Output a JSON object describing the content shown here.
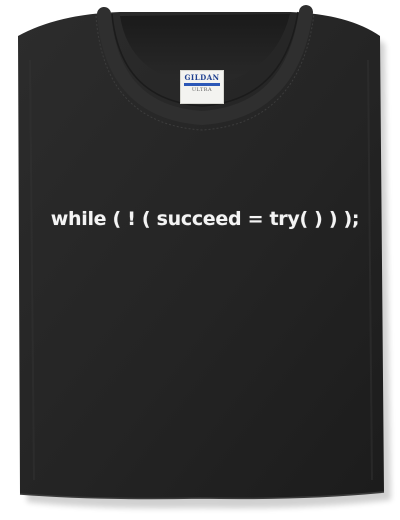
{
  "garment": {
    "type": "t-shirt",
    "fabric_color": "#262626",
    "print_color": "#f4f4f4",
    "print_text": "while ( ! ( succeed = try( ) ) );"
  },
  "label": {
    "brand": "GILDAN",
    "subtext": "ULTRA"
  },
  "background_color": "#ffffff"
}
